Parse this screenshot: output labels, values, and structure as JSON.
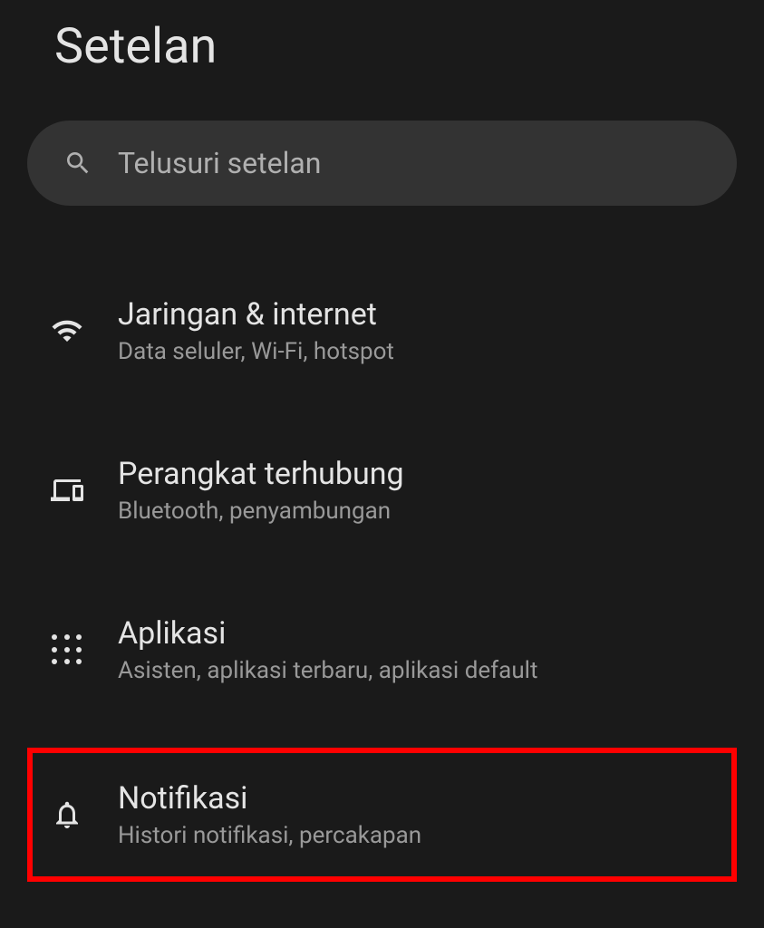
{
  "header": {
    "title": "Setelan"
  },
  "search": {
    "placeholder": "Telusuri setelan"
  },
  "items": [
    {
      "icon": "wifi-icon",
      "title": "Jaringan & internet",
      "subtitle": "Data seluler, Wi-Fi, hotspot",
      "highlighted": false
    },
    {
      "icon": "devices-icon",
      "title": "Perangkat terhubung",
      "subtitle": "Bluetooth, penyambungan",
      "highlighted": false
    },
    {
      "icon": "apps-icon",
      "title": "Aplikasi",
      "subtitle": "Asisten, aplikasi terbaru, aplikasi default",
      "highlighted": false
    },
    {
      "icon": "bell-icon",
      "title": "Notifikasi",
      "subtitle": "Histori notifikasi, percakapan",
      "highlighted": true
    }
  ]
}
